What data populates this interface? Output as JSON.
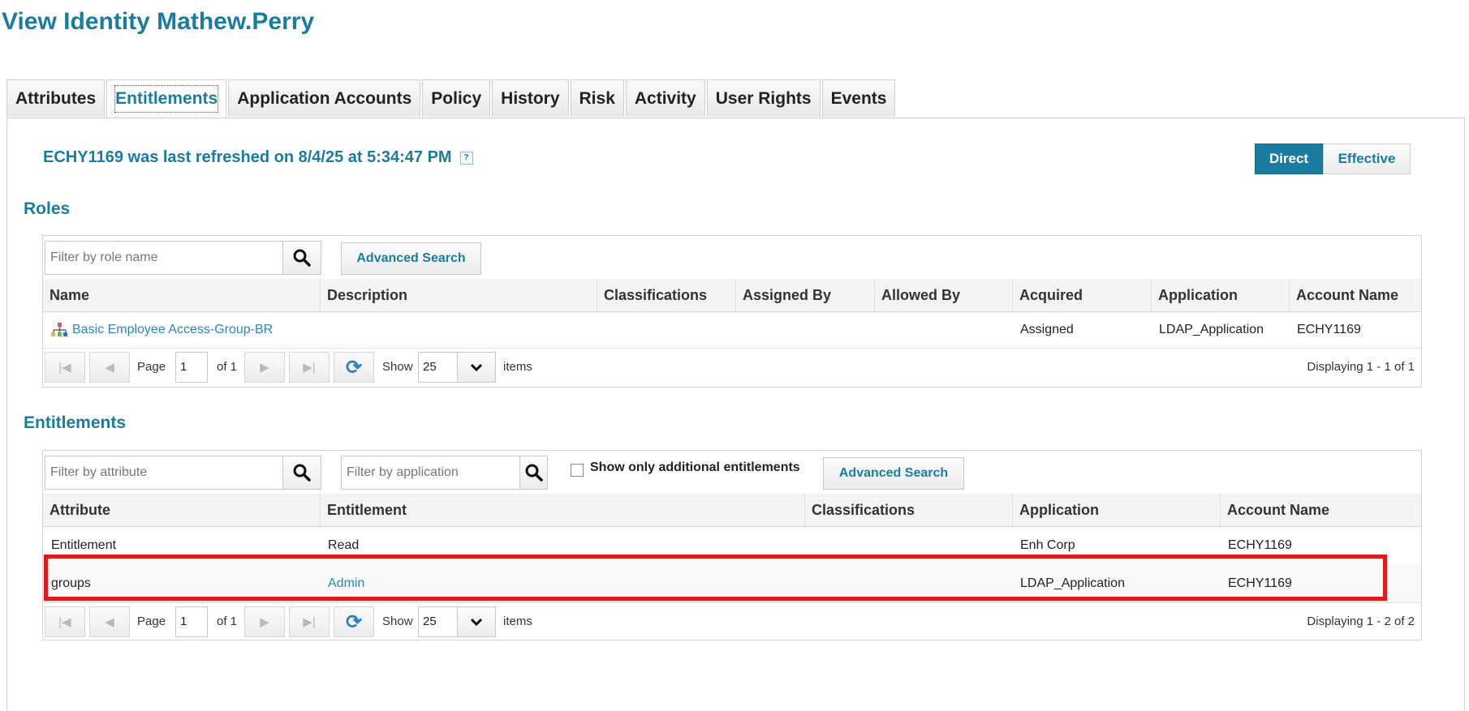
{
  "page": {
    "title": "View Identity Mathew.Perry"
  },
  "tabs": [
    {
      "label": "Attributes"
    },
    {
      "label": "Entitlements"
    },
    {
      "label": "Application Accounts"
    },
    {
      "label": "Policy"
    },
    {
      "label": "History"
    },
    {
      "label": "Risk"
    },
    {
      "label": "Activity"
    },
    {
      "label": "User Rights"
    },
    {
      "label": "Events"
    }
  ],
  "active_tab": "Entitlements",
  "refresh": {
    "text": "ECHY1169 was last refreshed on 8/4/25 at 5:34:47 PM",
    "help": "?"
  },
  "view_toggle": {
    "direct": "Direct",
    "effective": "Effective",
    "selected": "Direct"
  },
  "roles": {
    "title": "Roles",
    "filter_placeholder": "Filter by role name",
    "advanced_search": "Advanced Search",
    "columns": [
      "Name",
      "Description",
      "Classifications",
      "Assigned By",
      "Allowed By",
      "Acquired",
      "Application",
      "Account Name"
    ],
    "rows": [
      {
        "name": "Basic Employee Access-Group-BR",
        "description": "",
        "classifications": "",
        "assigned_by": "",
        "allowed_by": "",
        "acquired": "Assigned",
        "application": "LDAP_Application",
        "account_name": "ECHY1169"
      }
    ],
    "pager": {
      "page_label": "Page",
      "page": "1",
      "of": "of 1",
      "show": "Show",
      "page_size": "25",
      "items": "items",
      "display": "Displaying 1 - 1 of 1"
    }
  },
  "entitlements": {
    "title": "Entitlements",
    "attr_placeholder": "Filter by attribute",
    "app_placeholder": "Filter by application",
    "checkbox_label": "Show only additional entitlements",
    "checkbox_checked": false,
    "advanced_search": "Advanced Search",
    "columns": [
      "Attribute",
      "Entitlement",
      "Classifications",
      "Application",
      "Account Name"
    ],
    "rows": [
      {
        "attribute": "Entitlement",
        "entitlement": "Read",
        "classifications": "",
        "application": "Enh Corp",
        "account_name": "ECHY1169"
      },
      {
        "attribute": "groups",
        "entitlement": "Admin",
        "classifications": "",
        "application": "LDAP_Application",
        "account_name": "ECHY1169"
      }
    ],
    "pager": {
      "page_label": "Page",
      "page": "1",
      "of": "of 1",
      "show": "Show",
      "page_size": "25",
      "items": "items",
      "display": "Displaying 1 - 2 of 2"
    }
  },
  "highlight_color": "#e01b1b",
  "accent_color": "#1a7ca0"
}
